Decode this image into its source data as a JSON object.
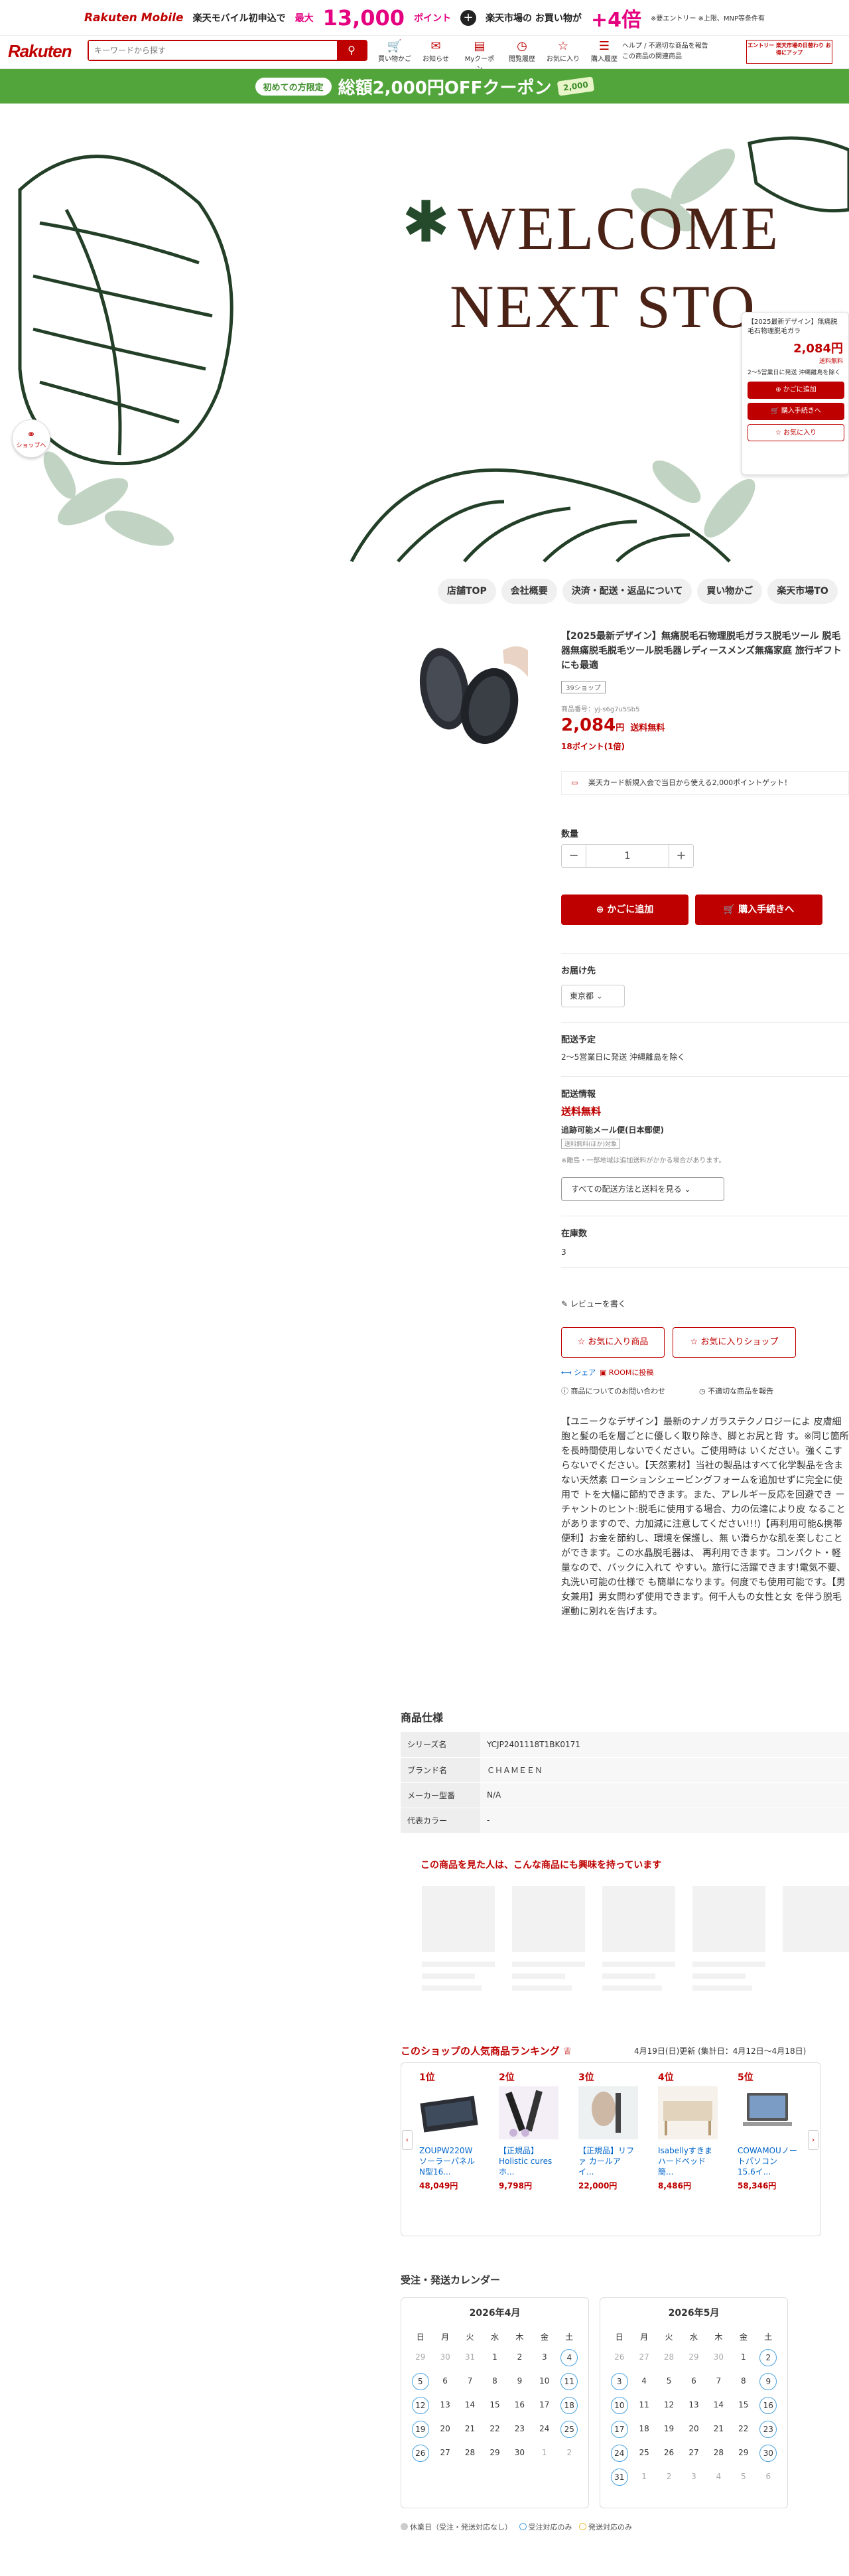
{
  "promo": {
    "brand": "Rakuten Mobile",
    "text1": "楽天モバイル初申込で",
    "max": "最大",
    "points": "13,000",
    "points_unit": "ポイント",
    "text2": "楽天市場の お買い物が",
    "multiplier": "+4倍",
    "note": "※要エントリー ※上限、MNP等条件有"
  },
  "header": {
    "logo": "Rakuten",
    "search_placeholder": "キーワードから探す",
    "nav": [
      {
        "label": "買い物かご",
        "icon": "cart-icon"
      },
      {
        "label": "お知らせ",
        "icon": "notification-icon"
      },
      {
        "label": "Myクーポン",
        "icon": "coupon-icon"
      },
      {
        "label": "閲覧履歴",
        "icon": "history-icon"
      },
      {
        "label": "お気に入り",
        "icon": "favorite-icon"
      },
      {
        "label": "購入履歴",
        "icon": "purchase-history-icon"
      }
    ],
    "help1": "ヘルプ / 不適切な商品を報告",
    "help2": "この商品の関連商品",
    "banner": "エントリー 楽天市場の日替わり お得にアップ"
  },
  "green_banner": {
    "pill": "初めての方限定",
    "message": "総額2,000円OFFクーポン",
    "coupon": "2,000"
  },
  "hero": {
    "line1": "WELCOME",
    "line2": "NEXT STO"
  },
  "side_cart": {
    "title": "【2025最新デザイン】無痛脱毛石物理脱毛ガラ",
    "price": "2,084円",
    "shipping": "送料無料",
    "delivery": "2～5営業日に発送 沖縄離島を除く",
    "add_cart": "かごに追加",
    "buy_now": "購入手続きへ",
    "favorite": "お気に入り"
  },
  "shop_link": "ショップへ",
  "store_nav": [
    "店舗TOP",
    "会社概要",
    "決済・配送・返品について",
    "買い物かご",
    "楽天市場TO"
  ],
  "product": {
    "title": "【2025最新デザイン】無痛脱毛石物理脱毛ガラス脱毛ツール 脱毛器無痛脱毛脱毛ツール脱毛器レディースメンズ無痛家庭 旅行ギフトにも最適",
    "tag": "39ショップ",
    "number": "商品番号：yj-s6g7u5Sb5",
    "price": "2,084",
    "price_unit": "円",
    "shipping": "送料無料",
    "points": "18ポイント(1倍)",
    "card_msg": "楽天カード新規入会で当日から使える2,000ポイントゲット！",
    "qty_label": "数量",
    "qty": "1",
    "add_cart": "かごに追加",
    "buy_now": "購入手続きへ",
    "dest_label": "お届け先",
    "dest_value": "東京都",
    "ship_plan_label": "配送予定",
    "ship_plan": "2～5営業日に発送 沖縄離島を除く",
    "ship_info_label": "配送情報",
    "ship_free": "送料無料",
    "ship_method": "追跡可能メール便(日本郵便)",
    "ship_method_tag": "送料無料(ほか)対象",
    "ship_note": "※離島・一部地域は追加送料がかかる場合があります。",
    "ship_select": "すべての配送方法と送料を見る",
    "stock_label": "在庫数",
    "stock": "3",
    "review": "レビューを書く",
    "fav_item": "お気に入り商品",
    "fav_shop": "お気に入りショップ",
    "share": "シェア",
    "room": "ROOMに投稿",
    "inquiry": "商品についてのお問い合わせ",
    "report": "不適切な商品を報告"
  },
  "description": "【ユニークなデザイン】最新のナノガラステクノロジーによ 皮膚細胞と髪の毛を層ごとに優しく取り除き、脚とお尻と背 す。※同じ箇所を長時間使用しないでください。ご使用時は いください。強くこすらないでください。【天然素材】当社の製品はすべて化学製品を含まない天然素 ローションシェービングフォームを追加せずに完全に使用で トを大幅に節約できます。また、アレルギー反応を回避でき ーチャントのヒント:脱毛に使用する場合、力の伝達により皮 なることがありますので、力加減に注意してください!!!)【再利用可能&携帯便利】お金を節約し、環境を保護し、無 い滑らかな肌を楽しむことができます。この水晶脱毛器は、 再利用できます。コンパクト・軽量なので、バックに入れて やすい。旅行に活躍できます!電気不要、丸洗い可能の仕様で も簡単になります。何度でも使用可能です。【男女兼用】男女問わず使用できます。何千人もの女性と女 を伴う脱毛運動に別れを告げます。",
  "spec": {
    "title": "商品仕様",
    "rows": [
      {
        "key": "シリーズ名",
        "value": "YCJP2401118T1BK0171"
      },
      {
        "key": "ブランド名",
        "value": "ＣＨＡＭＥＥＮ"
      },
      {
        "key": "メーカー型番",
        "value": "N/A"
      },
      {
        "key": "代表カラー",
        "value": "-"
      }
    ]
  },
  "recommend_title": "この商品を見た人は、こんな商品にも興味を持っています",
  "ranking": {
    "title": "このショップの人気商品ランキング",
    "date": "4月19日(日)更新 (集計日：4月12日～4月18日)",
    "items": [
      {
        "rank": "1位",
        "name": "ZOUPW220W ソーラーパネル N型16...",
        "price": "48,049円"
      },
      {
        "rank": "2位",
        "name": "【正規品】Holistic cures ホ...",
        "price": "9,798円"
      },
      {
        "rank": "3位",
        "name": "【正規品】リファ カールア イ...",
        "price": "22,000円"
      },
      {
        "rank": "4位",
        "name": "Isabellyすきま ハードベッド 簡...",
        "price": "8,486円"
      },
      {
        "rank": "5位",
        "name": "COWAMOUノートパソコン 15.6イ...",
        "price": "58,346円"
      }
    ]
  },
  "calendar": {
    "title": "受注・発送カレンダー",
    "weekdays": [
      "日",
      "月",
      "火",
      "水",
      "木",
      "金",
      "土"
    ],
    "months": [
      {
        "name": "2026年4月",
        "weeks": [
          [
            "29",
            "30",
            "31",
            "1",
            "2",
            "3",
            "4"
          ],
          [
            "5",
            "6",
            "7",
            "8",
            "9",
            "10",
            "11"
          ],
          [
            "12",
            "13",
            "14",
            "15",
            "16",
            "17",
            "18"
          ],
          [
            "19",
            "20",
            "21",
            "22",
            "23",
            "24",
            "25"
          ],
          [
            "26",
            "27",
            "28",
            "29",
            "30",
            "1",
            "2"
          ]
        ]
      },
      {
        "name": "2026年5月",
        "weeks": [
          [
            "26",
            "27",
            "28",
            "29",
            "30",
            "1",
            "2"
          ],
          [
            "3",
            "4",
            "5",
            "6",
            "7",
            "8",
            "9"
          ],
          [
            "10",
            "11",
            "12",
            "13",
            "14",
            "15",
            "16"
          ],
          [
            "17",
            "18",
            "19",
            "20",
            "21",
            "22",
            "23"
          ],
          [
            "24",
            "25",
            "26",
            "27",
            "28",
            "29",
            "30"
          ],
          [
            "31",
            "1",
            "2",
            "3",
            "4",
            "5",
            "6"
          ]
        ]
      }
    ],
    "legend": [
      "休業日（受注・発送対応なし）",
      "受注対応のみ",
      "発送対応のみ"
    ]
  },
  "colors": {
    "brand": "#bf0000",
    "green": "#52a53a",
    "calendar_ring": "#4aa3df"
  }
}
